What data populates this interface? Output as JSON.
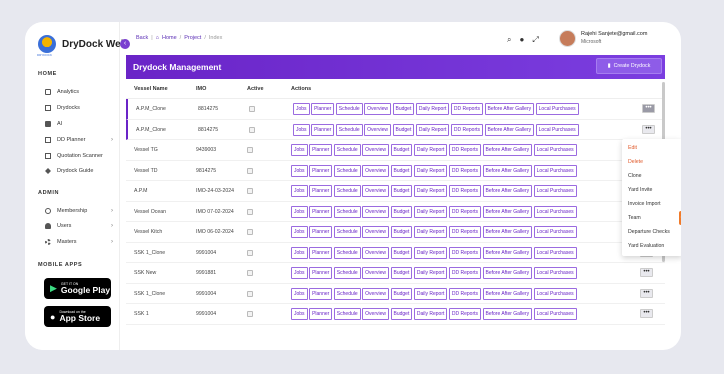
{
  "app": {
    "name": "DryDock Web",
    "logo_text": "DRYDOCK"
  },
  "breadcrumb": {
    "back": "Back",
    "home": "Home",
    "project": "Project",
    "current": "Index"
  },
  "user": {
    "email": "Rajehi Sanjete@gmail.com",
    "org": "Microsoft"
  },
  "sidebar": {
    "home_title": "HOME",
    "home_items": [
      {
        "label": "Analytics"
      },
      {
        "label": "Drydocks"
      },
      {
        "label": "AI"
      },
      {
        "label": "DD Planner"
      },
      {
        "label": "Quotation Scanner"
      },
      {
        "label": "Drydock Guide"
      }
    ],
    "admin_title": "ADMIN",
    "admin_items": [
      {
        "label": "Membership"
      },
      {
        "label": "Users"
      },
      {
        "label": "Masters"
      }
    ],
    "mobile_title": "MOBILE APPS",
    "google_play": {
      "small": "GET IT ON",
      "big": "Google Play"
    },
    "app_store": {
      "small": "Download on the",
      "big": "App Store"
    }
  },
  "panel": {
    "title": "Drydock Management",
    "create_label": "Create Drydock"
  },
  "table": {
    "headers": [
      "Vessel Name",
      "IMO",
      "Active",
      "Actions"
    ],
    "rows": [
      {
        "name": "A.P.M_Clone",
        "imo": "8814275"
      },
      {
        "name": "A.P.M_Clone",
        "imo": "8814275"
      },
      {
        "name": "Vessel TG",
        "imo": "9439003"
      },
      {
        "name": "Vessel TD",
        "imo": "9814275"
      },
      {
        "name": "A.P.M",
        "imo": "IMO-24-03-2024"
      },
      {
        "name": "Vessel Ocean",
        "imo": "IMO 07-02-2024"
      },
      {
        "name": "Vessel Kitch",
        "imo": "IMO 06-02-2024"
      },
      {
        "name": "SSK 1_Clone",
        "imo": "9991004"
      },
      {
        "name": "SSK New",
        "imo": "9991881"
      },
      {
        "name": "SSK 1_Clone",
        "imo": "9991004"
      },
      {
        "name": "SSK 1",
        "imo": "9991004"
      }
    ],
    "actions": [
      "Jobs",
      "Planner",
      "Schedule",
      "Overview",
      "Budget",
      "Daily Report",
      "DD Reports",
      "Before After Gallery",
      "Local Purchases"
    ],
    "more_label": "•••"
  },
  "dropdown": {
    "items": [
      "Edit",
      "Delete",
      "Clone",
      "Yard Invite",
      "Invoice Import",
      "Team",
      "Departure Checks",
      "Yard Evaluation"
    ]
  },
  "colors": {
    "primary": "#6a24c7",
    "danger": "#e05a2b"
  }
}
